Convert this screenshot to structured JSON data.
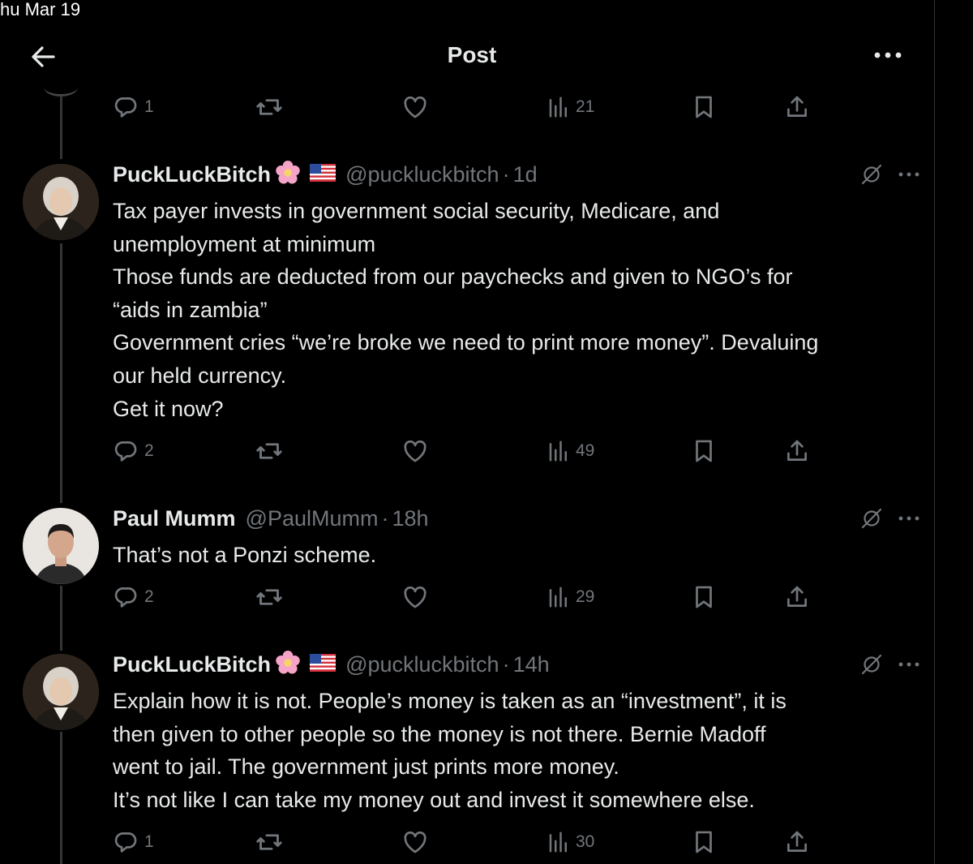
{
  "status": {
    "date": "hu Mar 19"
  },
  "header": {
    "title": "Post"
  },
  "top_actions": {
    "replies": "1",
    "views": "21"
  },
  "tweets": [
    {
      "name": "PuckLuckBitch",
      "handle": "@puckluckbitch",
      "separator": "·",
      "time": "1d",
      "lines": [
        "Tax payer invests in government social security, Medicare, and",
        "unemployment at minimum",
        "Those funds are deducted from our paychecks and given to NGO’s for",
        "“aids in zambia”",
        "Government cries “we’re broke we need to print more money”. Devaluing",
        "our held currency.",
        "Get it now?"
      ],
      "replies": "2",
      "views": "49"
    },
    {
      "name": "Paul Mumm",
      "handle": "@PaulMumm",
      "separator": "·",
      "time": "18h",
      "lines": [
        "That’s not a Ponzi scheme."
      ],
      "replies": "2",
      "views": "29"
    },
    {
      "name": "PuckLuckBitch",
      "handle": "@puckluckbitch",
      "separator": "·",
      "time": "14h",
      "lines": [
        "Explain how it is not.  People’s money is taken as an “investment”, it is",
        "then given to other people so the money is not there.  Bernie Madoff",
        "went to jail.  The government just prints more money.",
        "It’s not like I can take my money out and invest it somewhere else."
      ],
      "replies": "1",
      "views": "30"
    }
  ],
  "colors": {
    "background": "#000000",
    "text": "#e7e9ea",
    "muted": "#71767b",
    "thread_line": "#333639"
  },
  "icons": [
    "back-arrow-icon",
    "more-icon",
    "reply-icon",
    "repost-icon",
    "like-icon",
    "views-icon",
    "bookmark-icon",
    "share-icon",
    "grok-icon",
    "flower-emoji-icon",
    "us-flag-icon"
  ]
}
